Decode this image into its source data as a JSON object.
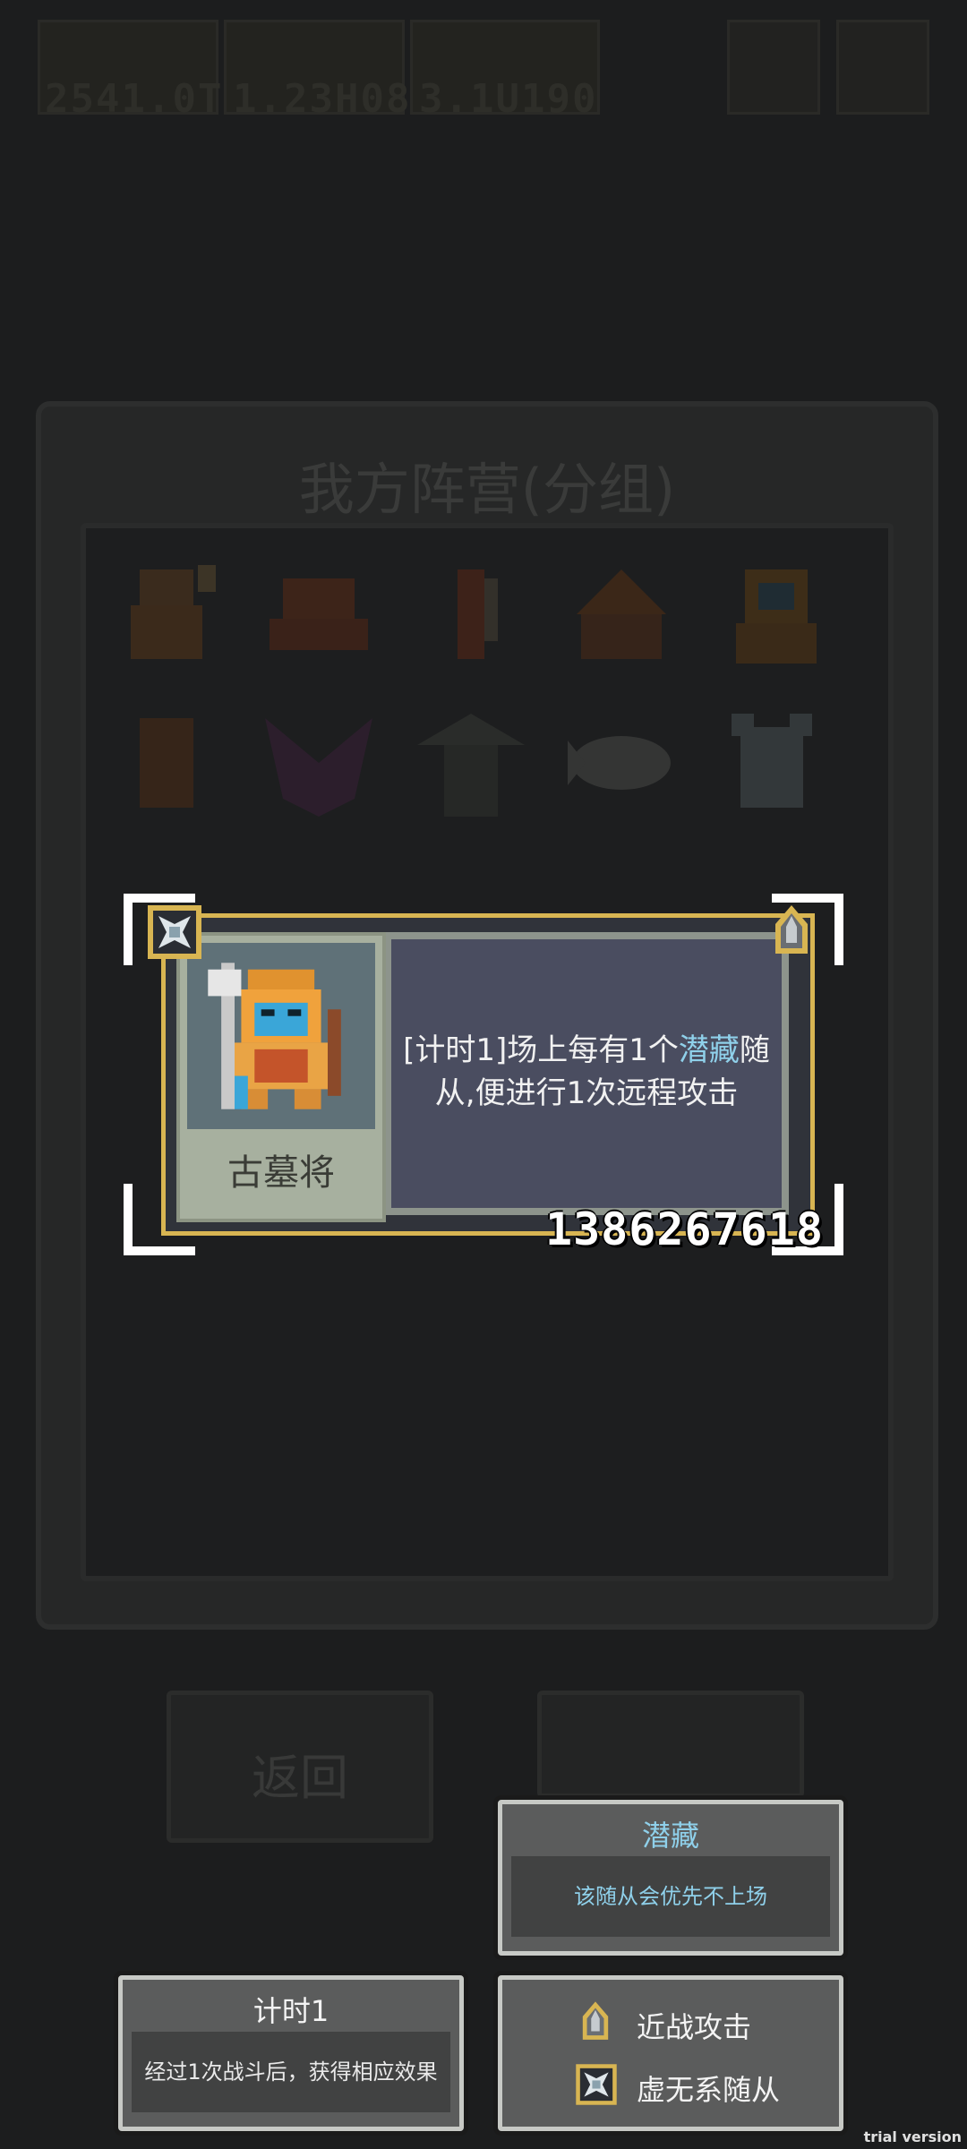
{
  "background": {
    "resources": [
      "2541.0T",
      "1.23H08",
      "3.1U190"
    ],
    "panel_title": "我方阵营(分组)",
    "back_label": "返回"
  },
  "card": {
    "name": "古墓将",
    "desc_prefix": "[计时1]场上每有1个",
    "desc_keyword": "潜藏",
    "desc_suffix": "随从,便进行1次远程攻击",
    "serial": "1386267618",
    "portrait_icon": "tomb-general-icon",
    "left_badge_icon": "void-crest-icon",
    "right_badge_icon": "melee-attack-icon"
  },
  "tooltips": {
    "lurk": {
      "title": "潜藏",
      "body": "该随从会优先不上场"
    },
    "timer": {
      "title": "计时1",
      "body": "经过1次战斗后，获得相应效果"
    },
    "traits": [
      {
        "icon": "melee-attack-icon",
        "label": "近战攻击"
      },
      {
        "icon": "void-crest-icon",
        "label": "虚无系随从"
      }
    ]
  },
  "watermark": "trial version",
  "colors": {
    "keyword": "#8fd0ea",
    "card_border": "#d8b552",
    "desc_bg": "#4a4d60"
  }
}
